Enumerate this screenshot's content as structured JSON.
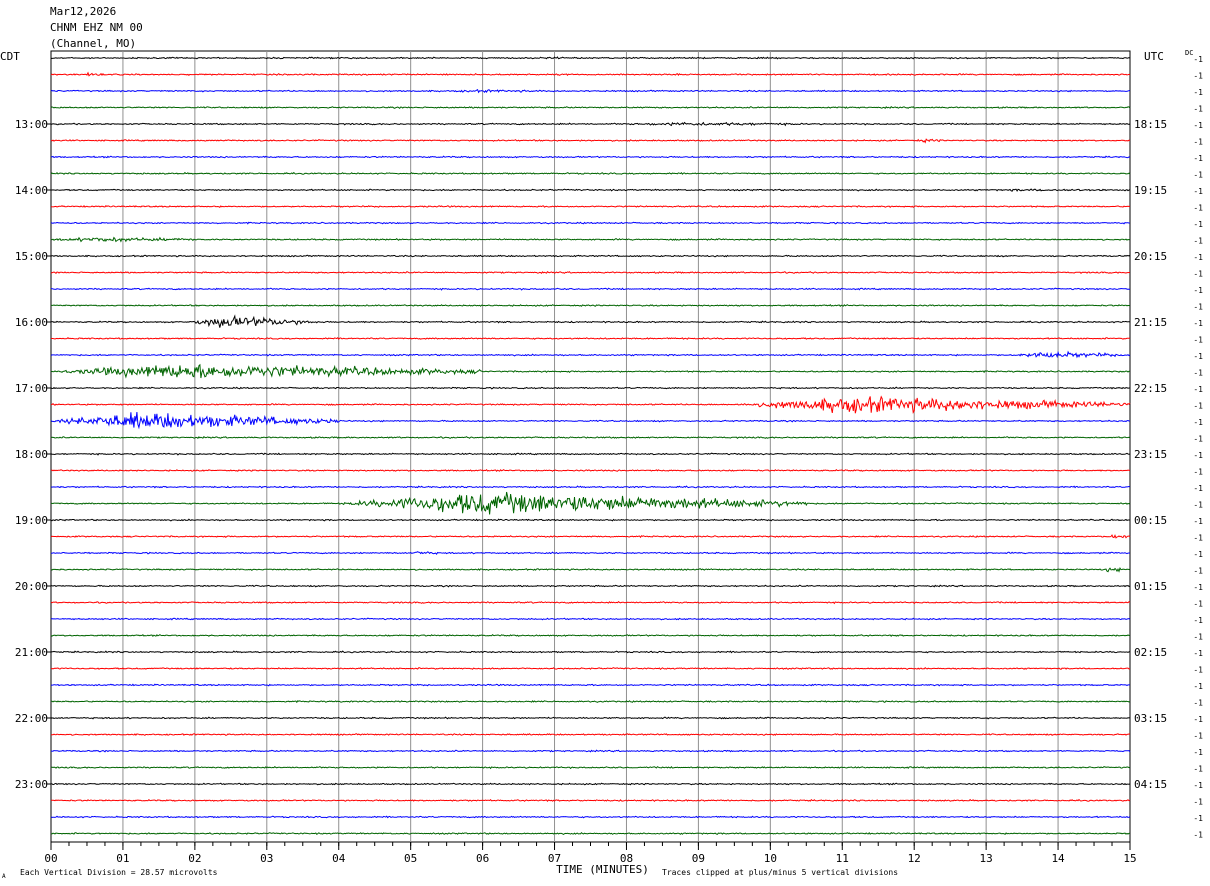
{
  "header": {
    "date": "Mar12,2026",
    "station": "CHNM EHZ NM 00",
    "channel": "(Channel, MO)"
  },
  "left_timezone": "CDT",
  "right_timezone": "UTC",
  "dc_label": "DC",
  "footer": {
    "scale_note": "Each Vertical Division =   28.57 microvolts",
    "clip_note": "Traces clipped at plus/minus 5 vertical divisions",
    "corner_mark": "A"
  },
  "chart_data": {
    "type": "line",
    "title": "",
    "xlabel": "TIME (MINUTES)",
    "ylabel": "",
    "xlim": [
      0,
      15
    ],
    "x_tick_labels": [
      "00",
      "01",
      "02",
      "03",
      "04",
      "05",
      "06",
      "07",
      "08",
      "09",
      "10",
      "11",
      "12",
      "13",
      "14",
      "15"
    ],
    "left_hour_labels": [
      "13:00",
      "14:00",
      "15:00",
      "16:00",
      "17:00",
      "18:00",
      "19:00",
      "20:00",
      "21:00",
      "22:00",
      "23:00"
    ],
    "right_hour_labels": [
      "18:15",
      "19:15",
      "20:15",
      "21:15",
      "22:15",
      "23:15",
      "00:15",
      "01:15",
      "02:15",
      "03:15",
      "04:15"
    ],
    "first_labeled_trace": 4,
    "trace_count": 48,
    "trace_right_value": "-1",
    "trace_colors": [
      "#000000",
      "#ff0000",
      "#0000ff",
      "#006400"
    ],
    "grid": true,
    "events": [
      {
        "trace": 0,
        "start": 6.8,
        "end": 7.2,
        "amp": 0.6
      },
      {
        "trace": 1,
        "start": 0.4,
        "end": 0.8,
        "amp": 0.8
      },
      {
        "trace": 2,
        "start": 5.5,
        "end": 7.0,
        "amp": 0.6
      },
      {
        "trace": 4,
        "start": 8.0,
        "end": 10.5,
        "amp": 1.0
      },
      {
        "trace": 5,
        "start": 12.0,
        "end": 12.4,
        "amp": 1.0
      },
      {
        "trace": 8,
        "start": 13.0,
        "end": 15.0,
        "amp": 0.5
      },
      {
        "trace": 11,
        "start": 0.0,
        "end": 2.1,
        "amp": 1.5
      },
      {
        "trace": 16,
        "start": 1.9,
        "end": 3.7,
        "amp": 4.5
      },
      {
        "trace": 18,
        "start": 13.3,
        "end": 15.0,
        "amp": 2.2
      },
      {
        "trace": 19,
        "start": 0.0,
        "end": 6.0,
        "amp": 6.0
      },
      {
        "trace": 21,
        "start": 9.5,
        "end": 15.0,
        "amp": 6.5
      },
      {
        "trace": 22,
        "start": 0.0,
        "end": 4.0,
        "amp": 7.0
      },
      {
        "trace": 27,
        "start": 4.0,
        "end": 10.5,
        "amp": 9.0
      },
      {
        "trace": 29,
        "start": 14.7,
        "end": 15.0,
        "amp": 1.5
      },
      {
        "trace": 30,
        "start": 5.0,
        "end": 5.4,
        "amp": 1.2
      },
      {
        "trace": 31,
        "start": 14.6,
        "end": 15.0,
        "amp": 1.5
      }
    ]
  }
}
